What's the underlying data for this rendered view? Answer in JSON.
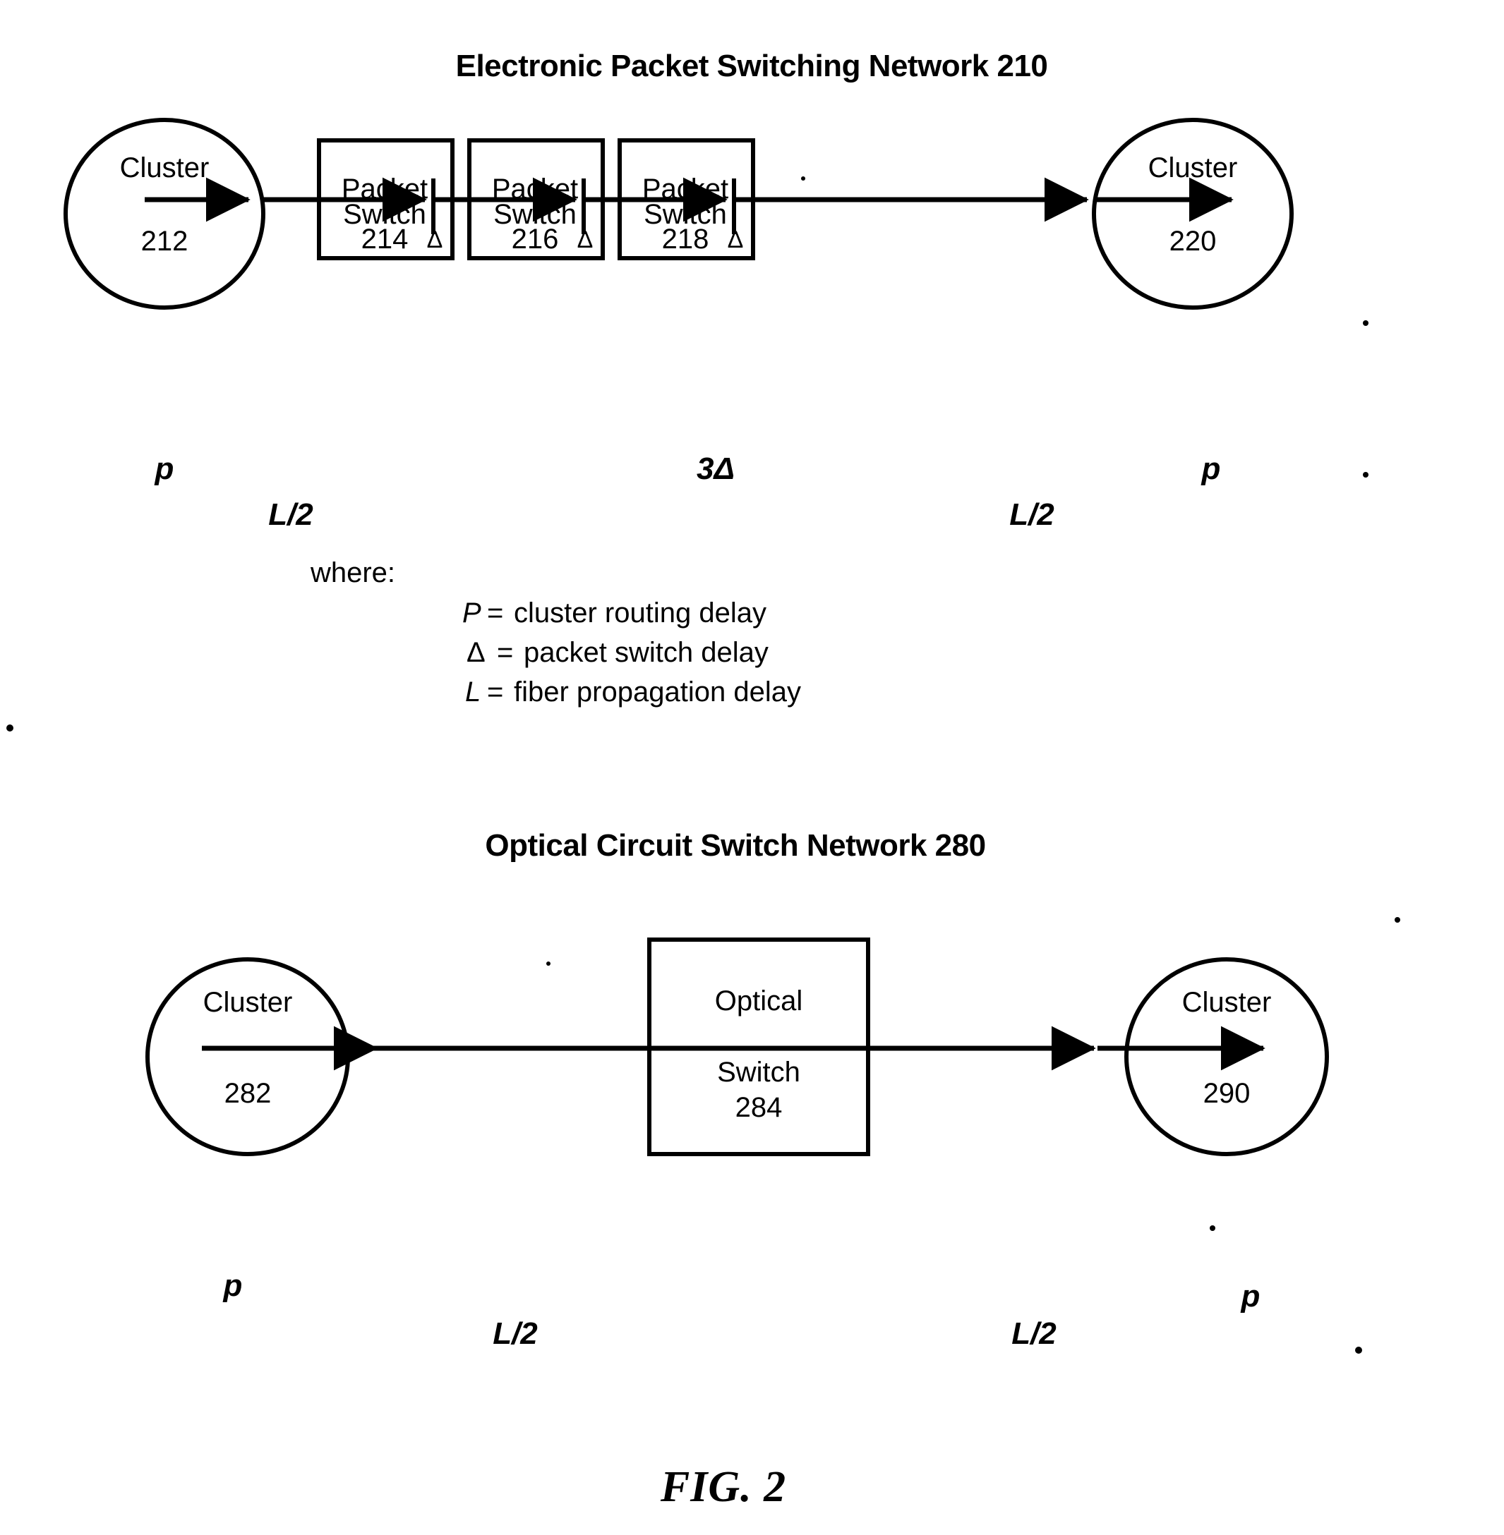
{
  "figure": {
    "label": "FIG. 2"
  },
  "diagram_top": {
    "title": "Electronic Packet Switching Network 210",
    "source_cluster": {
      "label": "Cluster",
      "number": "212"
    },
    "dest_cluster": {
      "label": "Cluster",
      "number": "220"
    },
    "switches": [
      {
        "line1": "Packet",
        "line2": "Switch",
        "number": "214",
        "delay_symbol": "Δ"
      },
      {
        "line1": "Packet",
        "line2": "Switch",
        "number": "216",
        "delay_symbol": "Δ"
      },
      {
        "line1": "Packet",
        "line2": "Switch",
        "number": "218",
        "delay_symbol": "Δ"
      }
    ],
    "annotations": {
      "left_p": "p",
      "left_half_l": "L/2",
      "center_delay": "3Δ",
      "right_half_l": "L/2",
      "right_p": "p"
    }
  },
  "legend": {
    "heading": "where:",
    "entries": [
      {
        "symbol": "P",
        "separator": "=",
        "description": "cluster routing delay"
      },
      {
        "symbol": "Δ",
        "separator": "=",
        "description": "packet switch delay"
      },
      {
        "symbol": "L",
        "separator": "=",
        "description": "fiber propagation delay"
      }
    ]
  },
  "diagram_bottom": {
    "title": "Optical Circuit Switch Network  280",
    "source_cluster": {
      "label": "Cluster",
      "number": "282"
    },
    "dest_cluster": {
      "label": "Cluster",
      "number": "290"
    },
    "switch": {
      "line1": "Optical",
      "line2": "Switch",
      "number": "284"
    },
    "annotations": {
      "left_p": "p",
      "left_half_l": "L/2",
      "right_half_l": "L/2",
      "right_p": "p"
    }
  },
  "colors": {
    "ink": "#000000",
    "paper": "#ffffff"
  }
}
